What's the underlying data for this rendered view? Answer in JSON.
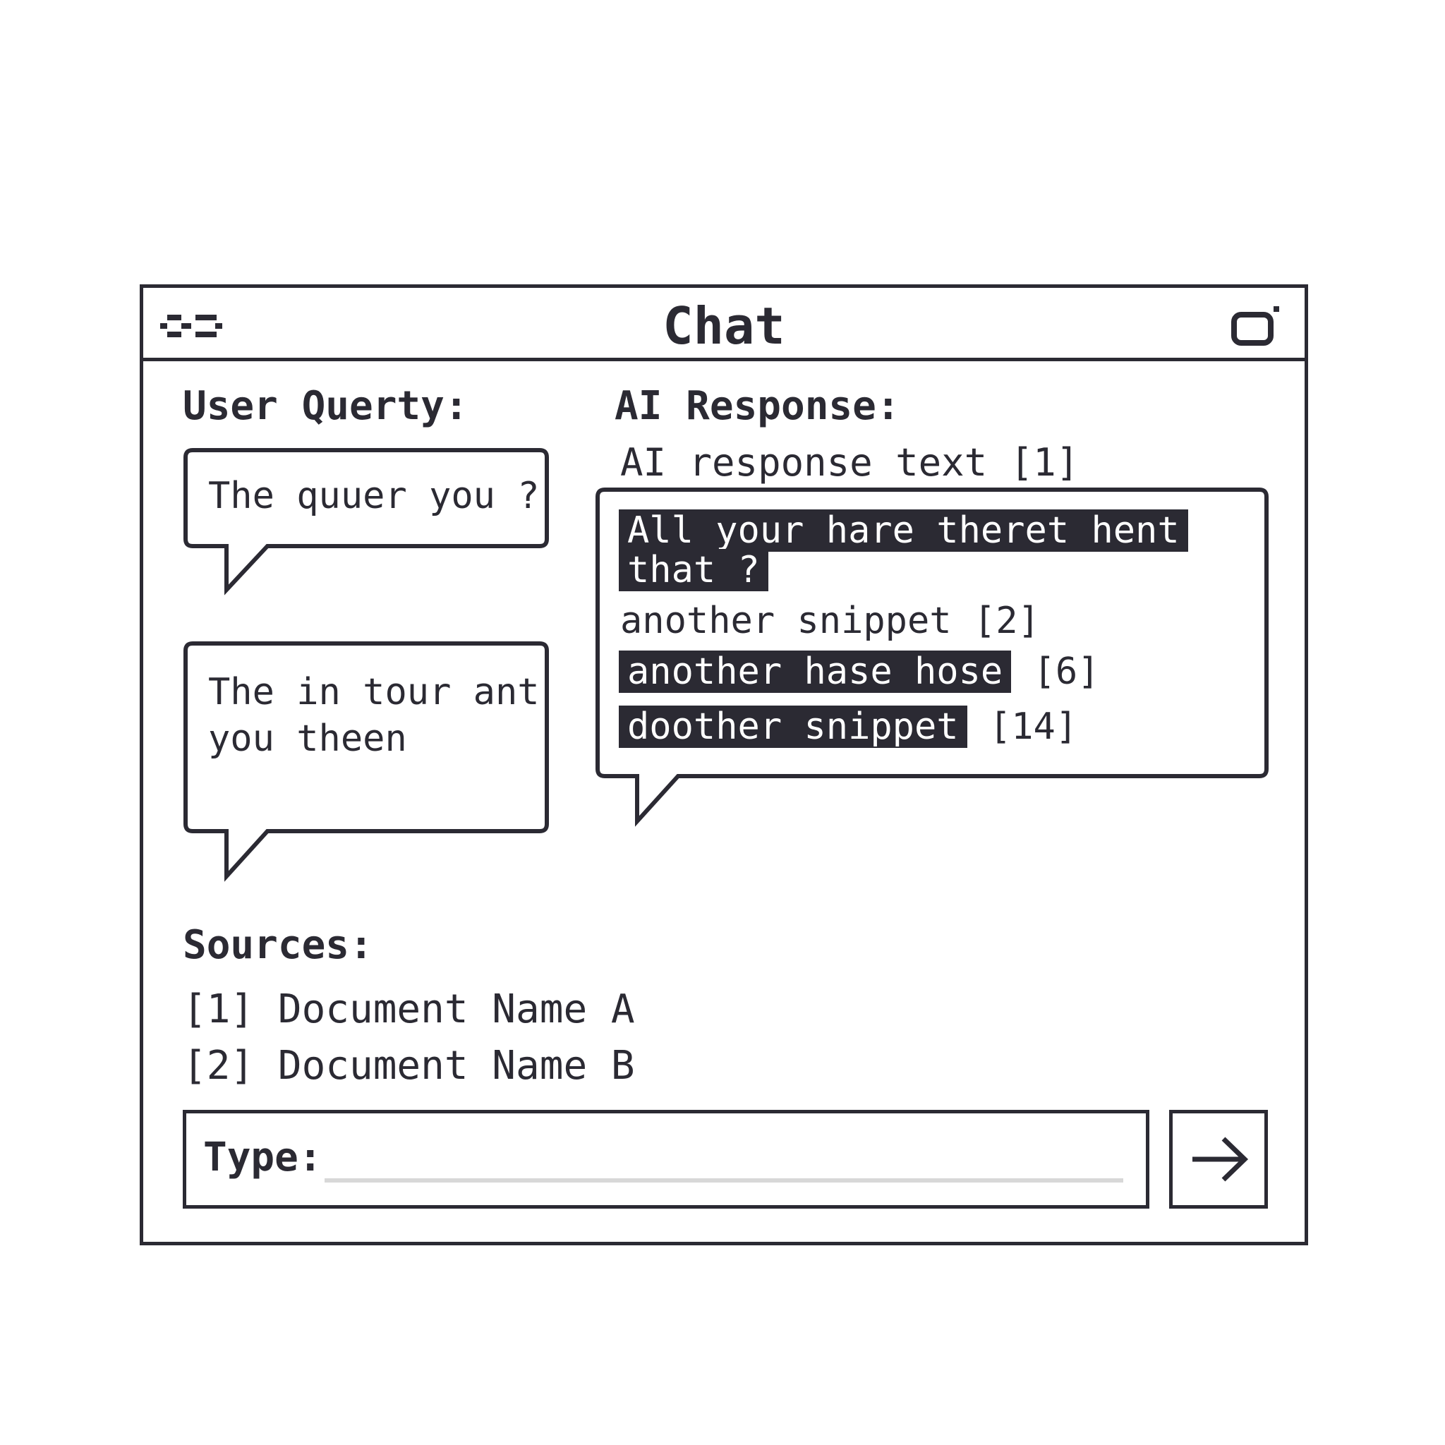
{
  "window": {
    "title": "Chat"
  },
  "icons": {
    "menu": "menu-icon",
    "expand": "expand-icon",
    "send": "arrow-right-icon"
  },
  "user": {
    "heading": "User Querty:",
    "messages": [
      "The quuer you ?",
      "The in tour ant\nyou theen"
    ]
  },
  "ai": {
    "heading": "AI Response:",
    "intro": "AI response text [1]",
    "lines": [
      {
        "highlight": "All your hare theret hent",
        "ref": ""
      },
      {
        "highlight": "that ?",
        "ref": ""
      },
      {
        "highlight": "",
        "ref": "another snippet [2]"
      },
      {
        "highlight": "another hase hose",
        "ref": "[6]"
      },
      {
        "highlight": "doother snippet",
        "ref": "[14]"
      }
    ]
  },
  "sources": {
    "heading": "Sources:",
    "items": [
      "[1] Document Name A",
      "[2] Document Name B"
    ]
  },
  "composer": {
    "label": "Type:",
    "value": ""
  },
  "colors": {
    "ink": "#2b2a33",
    "background": "#ffffff",
    "input_line": "#d8d8d8"
  }
}
